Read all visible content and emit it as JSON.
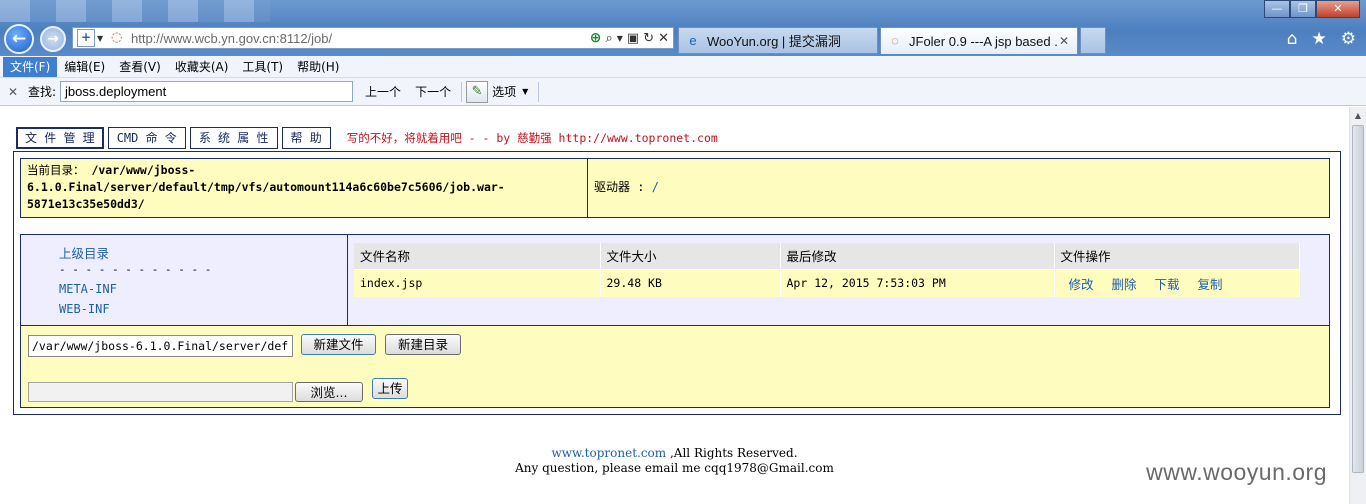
{
  "browser": {
    "address_url": "http://www.wcb.yn.gov.cn:8112/job/",
    "tabs": [
      {
        "label": "WooYun.org | 提交漏洞",
        "active": false
      },
      {
        "label": "JFoler 0.9 ---A jsp based ...",
        "active": true
      }
    ],
    "window_buttons": {
      "minimize": "—",
      "maximize": "❐",
      "close": "✕"
    },
    "menu": [
      "文件(F)",
      "编辑(E)",
      "查看(V)",
      "收藏夹(A)",
      "工具(T)",
      "帮助(H)"
    ],
    "find": {
      "label": "查找:",
      "value": "jboss.deployment",
      "prev": "上一个",
      "next": "下一个",
      "options": "选项"
    }
  },
  "page": {
    "nav": [
      "文 件 管 理",
      "CMD 命 令",
      "系 统 属 性",
      "帮 助"
    ],
    "note": "写的不好，将就着用吧 - - by 慈勤强 http://www.topronet.com",
    "current_dir_label": "当前目录：",
    "current_dir": "/var/www/jboss-6.1.0.Final/server/default/tmp/vfs/automount114a6c60be7c5606/job.war-5871e13c35e50dd3/",
    "drive_label": "驱动器 :",
    "drive": "/",
    "dir_up": "上级目录",
    "dir_separator": "- - - - - - - - - - - -",
    "dirs": [
      "META-INF",
      "WEB-INF"
    ],
    "file_table": {
      "headers": [
        "文件名称",
        "文件大小",
        "最后修改",
        "文件操作"
      ],
      "rows": [
        {
          "name": "index.jsp",
          "size": "29.48 KB",
          "modified": "Apr 12, 2015 7:53:03 PM",
          "ops": [
            "修改",
            "删除",
            "下载",
            "复制"
          ]
        }
      ]
    },
    "path_input_value": "/var/www/jboss-6.1.0.Final/server/def",
    "new_file_button": "新建文件",
    "new_dir_button": "新建目录",
    "browse_button": "浏览...",
    "upload_button": "上传",
    "footer_site": "www.topronet.com",
    "footer_rights": " ,All Rights Reserved.",
    "footer_contact": "Any question, please email me cqq1978@Gmail.com"
  },
  "watermark": "www.wooyun.org"
}
